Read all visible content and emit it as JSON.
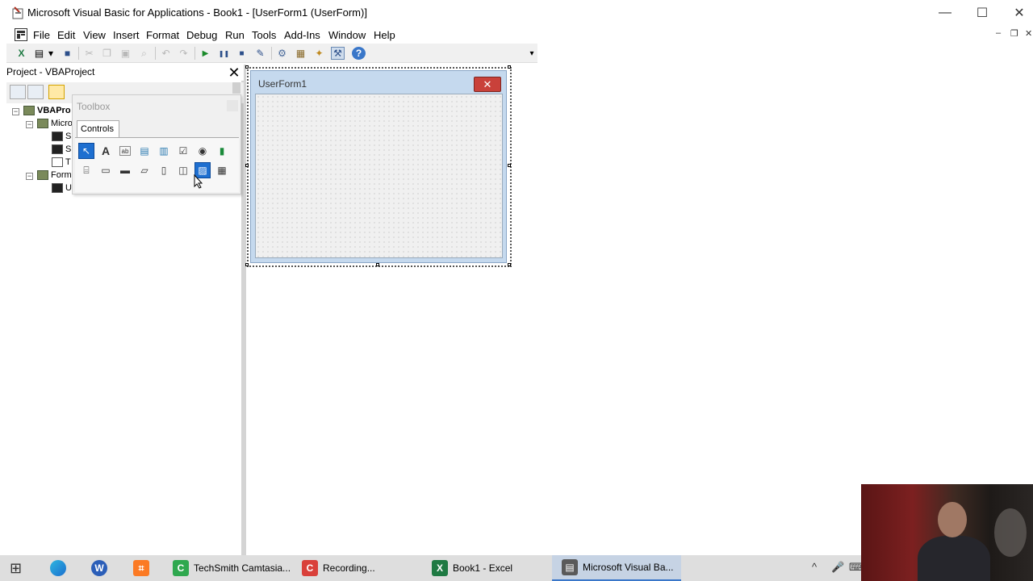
{
  "window": {
    "title": "Microsoft Visual Basic for Applications - Book1 - [UserForm1 (UserForm)]",
    "minimize": "—",
    "maximize": "☐",
    "close": "✕"
  },
  "menu": {
    "items": [
      "File",
      "Edit",
      "View",
      "Insert",
      "Format",
      "Debug",
      "Run",
      "Tools",
      "Add-Ins",
      "Window",
      "Help"
    ],
    "mdi_minimize": "‒",
    "mdi_restore": "❐",
    "mdi_close": "✕"
  },
  "toolbar": {
    "icons": [
      "excel-view-icon",
      "insert-userform-icon",
      "dropdown-icon",
      "save-icon",
      "cut-icon",
      "copy-icon",
      "paste-icon",
      "find-icon",
      "undo-icon",
      "redo-icon",
      "run-icon",
      "break-icon",
      "reset-icon",
      "design-mode-icon",
      "project-explorer-icon",
      "properties-icon",
      "object-browser-icon",
      "toolbox-icon",
      "help-icon"
    ],
    "glyphs": {
      "excel": "X",
      "userform": "▤",
      "dropdown": "▾",
      "save": "■",
      "cut": "✂",
      "copy": "❐",
      "paste": "▣",
      "find": "⌕",
      "undo": "↶",
      "redo": "↷",
      "run": "▶",
      "break": "❚❚",
      "reset": "■",
      "design": "✎",
      "explorer": "⚙",
      "properties": "▦",
      "browser": "✦",
      "toolbox": "⚒",
      "help": "?"
    }
  },
  "project_panel": {
    "title": "Project - VBAProject",
    "close": "✕",
    "tree": [
      {
        "label": "VBAPro",
        "expander": "−",
        "bold": true
      },
      {
        "label": "Micro",
        "expander": "−"
      },
      {
        "label": "S"
      },
      {
        "label": "S"
      },
      {
        "label": "T"
      },
      {
        "label": "Form",
        "expander": "−"
      },
      {
        "label": "U"
      }
    ]
  },
  "toolbox": {
    "title": "Toolbox",
    "tab": "Controls",
    "controls": [
      {
        "name": "select-objects",
        "glyph": "↖"
      },
      {
        "name": "label",
        "glyph": "A"
      },
      {
        "name": "textbox",
        "glyph": "ab"
      },
      {
        "name": "combobox",
        "glyph": "▤"
      },
      {
        "name": "listbox",
        "glyph": "▥"
      },
      {
        "name": "checkbox",
        "glyph": "☑"
      },
      {
        "name": "optionbutton",
        "glyph": "◉"
      },
      {
        "name": "togglebutton",
        "glyph": "▮"
      },
      {
        "name": "frame",
        "glyph": "⌸"
      },
      {
        "name": "commandbutton",
        "glyph": "▭"
      },
      {
        "name": "tabstrip",
        "glyph": "▬"
      },
      {
        "name": "multipage",
        "glyph": "▱"
      },
      {
        "name": "scrollbar",
        "glyph": "▯"
      },
      {
        "name": "spinbutton",
        "glyph": "◫"
      },
      {
        "name": "image",
        "glyph": "▨"
      },
      {
        "name": "refedit",
        "glyph": "▦"
      }
    ]
  },
  "userform": {
    "title": "UserForm1",
    "close": "✕"
  },
  "taskbar": {
    "start": "⊞",
    "apps": [
      {
        "label": "TechSmith Camtasia...",
        "icon": "C",
        "color": "#2fa84f"
      },
      {
        "label": "Recording...",
        "icon": "C",
        "color": "#d9403a"
      },
      {
        "label": "Book1 - Excel",
        "icon": "X",
        "color": "#1f7a43"
      },
      {
        "label": "Microsoft Visual Ba...",
        "icon": "▤",
        "color": "#5a5a5a"
      }
    ],
    "tray": [
      "^",
      "🎤",
      "⌨"
    ]
  },
  "colors": {
    "selected_control": "#1e6fd0",
    "form_title_bg": "#c5d9ee",
    "close_red": "#c9413a",
    "taskbar_active": "#c6d3e4"
  }
}
